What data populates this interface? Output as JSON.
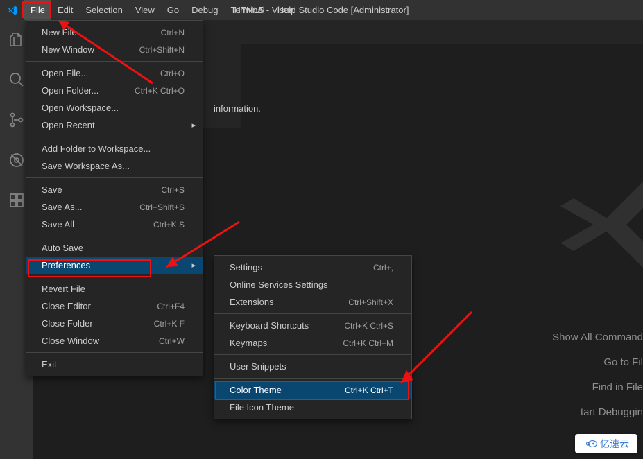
{
  "titlebar": {
    "menus": [
      "File",
      "Edit",
      "Selection",
      "View",
      "Go",
      "Debug",
      "Terminal",
      "Help"
    ],
    "title": "HTML5 - Visual Studio Code [Administrator]"
  },
  "editor": {
    "info_text": "information."
  },
  "hints": {
    "items": [
      "Show All Command",
      "Go to Fil",
      "Find in File",
      "tart Debuggin"
    ]
  },
  "file_menu": {
    "groups": [
      [
        {
          "label": "New File",
          "shortcut": "Ctrl+N"
        },
        {
          "label": "New Window",
          "shortcut": "Ctrl+Shift+N"
        }
      ],
      [
        {
          "label": "Open File...",
          "shortcut": "Ctrl+O"
        },
        {
          "label": "Open Folder...",
          "shortcut": "Ctrl+K Ctrl+O"
        },
        {
          "label": "Open Workspace...",
          "shortcut": ""
        },
        {
          "label": "Open Recent",
          "shortcut": "",
          "submenu": true
        }
      ],
      [
        {
          "label": "Add Folder to Workspace...",
          "shortcut": ""
        },
        {
          "label": "Save Workspace As...",
          "shortcut": ""
        }
      ],
      [
        {
          "label": "Save",
          "shortcut": "Ctrl+S"
        },
        {
          "label": "Save As...",
          "shortcut": "Ctrl+Shift+S"
        },
        {
          "label": "Save All",
          "shortcut": "Ctrl+K S"
        }
      ],
      [
        {
          "label": "Auto Save",
          "shortcut": ""
        },
        {
          "label": "Preferences",
          "shortcut": "",
          "submenu": true,
          "selected": true
        }
      ],
      [
        {
          "label": "Revert File",
          "shortcut": ""
        },
        {
          "label": "Close Editor",
          "shortcut": "Ctrl+F4"
        },
        {
          "label": "Close Folder",
          "shortcut": "Ctrl+K F"
        },
        {
          "label": "Close Window",
          "shortcut": "Ctrl+W"
        }
      ],
      [
        {
          "label": "Exit",
          "shortcut": ""
        }
      ]
    ]
  },
  "pref_menu": {
    "groups": [
      [
        {
          "label": "Settings",
          "shortcut": "Ctrl+,"
        },
        {
          "label": "Online Services Settings",
          "shortcut": ""
        },
        {
          "label": "Extensions",
          "shortcut": "Ctrl+Shift+X"
        }
      ],
      [
        {
          "label": "Keyboard Shortcuts",
          "shortcut": "Ctrl+K Ctrl+S"
        },
        {
          "label": "Keymaps",
          "shortcut": "Ctrl+K Ctrl+M"
        }
      ],
      [
        {
          "label": "User Snippets",
          "shortcut": ""
        }
      ],
      [
        {
          "label": "Color Theme",
          "shortcut": "Ctrl+K Ctrl+T",
          "selected": true
        },
        {
          "label": "File Icon Theme",
          "shortcut": ""
        }
      ]
    ]
  },
  "badge": {
    "text": "亿速云"
  },
  "annotations": {
    "color": "#e11"
  }
}
